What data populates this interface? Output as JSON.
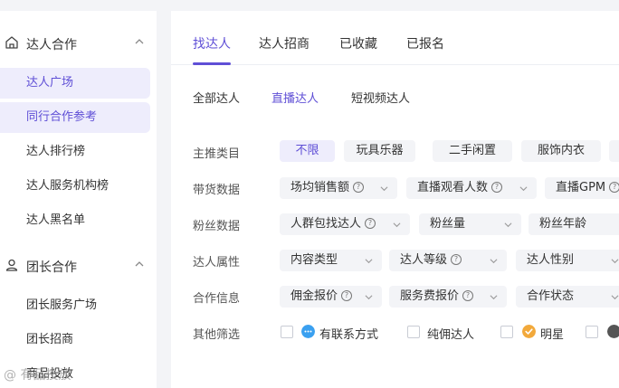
{
  "sidebar": {
    "group1": {
      "label": "达人合作",
      "icon": "home-icon"
    },
    "group1_items": [
      "达人广场",
      "同行合作参考",
      "达人排行榜",
      "达人服务机构榜",
      "达人黑名单"
    ],
    "group2": {
      "label": "团长合作",
      "icon": "user-group-icon"
    },
    "group2_items": [
      "团长服务广场",
      "团长招商",
      "商品投放"
    ]
  },
  "tabs": [
    "找达人",
    "达人招商",
    "已收藏",
    "已报名"
  ],
  "subtabs": [
    "全部达人",
    "直播达人",
    "短视频达人"
  ],
  "filters": {
    "category": {
      "label": "主推类目",
      "options": [
        "不限",
        "玩具乐器",
        "二手闲置",
        "服饰内衣"
      ]
    },
    "sales": {
      "label": "带货数据",
      "dropdowns": [
        "场均销售额",
        "直播观看人数",
        "直播GPM"
      ]
    },
    "fans": {
      "label": "粉丝数据",
      "dropdowns": [
        "人群包找达人",
        "粉丝量",
        "粉丝年龄"
      ]
    },
    "attrs": {
      "label": "达人属性",
      "dropdowns": [
        "内容类型",
        "达人等级",
        "达人性别"
      ]
    },
    "coop": {
      "label": "合作信息",
      "dropdowns": [
        "佣金报价",
        "服务费报价",
        "合作状态"
      ]
    },
    "other": {
      "label": "其他筛选",
      "checks": [
        "有联系方式",
        "纯佣达人",
        "明星"
      ]
    }
  },
  "watermark": "有品投放",
  "colors": {
    "accent": "#5f4fd6",
    "accent_bg": "#eeedfc",
    "chip_bg": "#f3f4f7"
  }
}
